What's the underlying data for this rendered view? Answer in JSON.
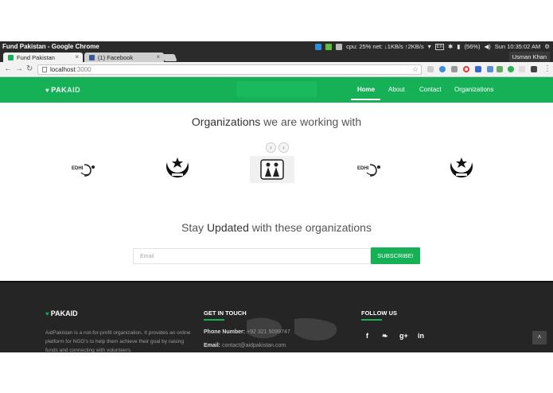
{
  "window": {
    "title": "Fund Pakistan - Google Chrome"
  },
  "tray": {
    "cpu_net": "cpu: 25% net: ↓1KB/s ↑2KB/s",
    "lang": "En",
    "battery": "(56%)",
    "clock": "Sun 10:35:02 AM"
  },
  "tabs": [
    {
      "label": "Fund Pakistan"
    },
    {
      "label": "(1) Facebook"
    }
  ],
  "user": "Usman Khan",
  "address": {
    "host": "localhost",
    "port": ":3000"
  },
  "site": {
    "logo_heart": "♥",
    "logo_pak": "PAK",
    "logo_aid": "AID",
    "nav": [
      "Home",
      "About",
      "Contact",
      "Organizations"
    ]
  },
  "organizations": {
    "title_bold": "Organizations",
    "title_rest": " we are working with",
    "prev": "‹",
    "next": "›"
  },
  "subscribe": {
    "title_pre": "Stay ",
    "title_bold": "Updated",
    "title_rest": " with these organizations",
    "email_placeholder": "Email",
    "button": "SUBSCRIBE!"
  },
  "footer": {
    "about": "AidPakistan is a not-for-profit organization. It provides an online platform for NGO's to help them achieve their goal by raising funds and connecting with volunteers.",
    "get_in_touch": "GET IN TOUCH",
    "phone_label": "Phone Number:",
    "phone": " +92 321 5099747",
    "email_label": "Email:",
    "email": " contact@aidpakistan.com",
    "follow_us": "FOLLOW US",
    "socials": [
      "f",
      "❧",
      "g+",
      "in"
    ],
    "to_top": "˄"
  },
  "colors": {
    "brand_green": "#16b157",
    "footer_bg": "#252525",
    "chrome_dark": "#2b2b2b"
  }
}
